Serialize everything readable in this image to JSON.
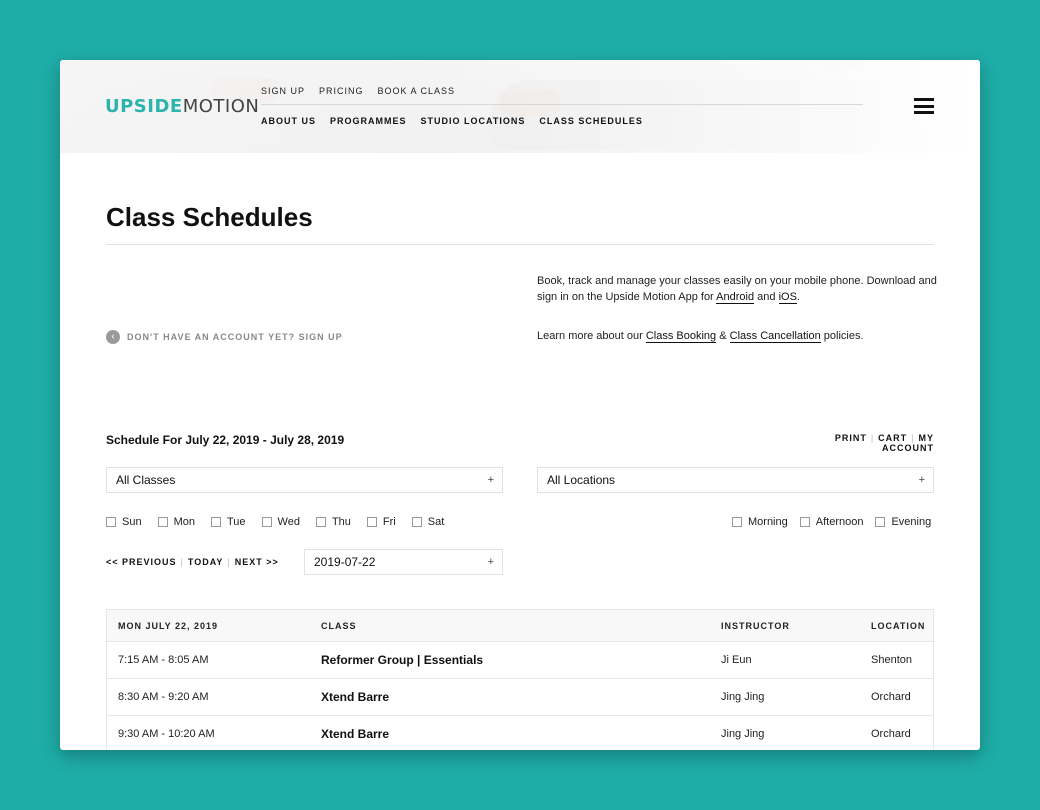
{
  "brand": {
    "logo_part1": "UPSIDE",
    "logo_part2": "MOTION",
    "accent_color": "#2bb3ad",
    "background_color": "#1fada8"
  },
  "nav": {
    "top": [
      "SIGN UP",
      "PRICING",
      "BOOK A CLASS"
    ],
    "main": [
      "ABOUT US",
      "PROGRAMMES",
      "STUDIO LOCATIONS",
      "CLASS SCHEDULES"
    ],
    "menu_icon": "hamburger-icon"
  },
  "page": {
    "title": "Class Schedules",
    "signup_link": "DON'T HAVE AN ACCOUNT YET? SIGN UP",
    "info_line1_pre": "Book, track and manage your classes easily on your mobile phone. Download and sign in on the Upside Motion App for ",
    "info_android": "Android",
    "info_and": " and ",
    "info_ios": "iOS",
    "info_line1_end": ".",
    "info_line2_pre": "Learn more about our ",
    "info_booking": "Class Booking",
    "info_amp": " & ",
    "info_cancellation": "Class Cancellation",
    "info_line2_end": " policies."
  },
  "schedule": {
    "heading": "Schedule For July 22, 2019 - July 28, 2019",
    "links": [
      "PRINT",
      "CART",
      "MY ACCOUNT"
    ],
    "class_filter": "All Classes",
    "location_filter": "All Locations",
    "days": [
      "Sun",
      "Mon",
      "Tue",
      "Wed",
      "Thu",
      "Fri",
      "Sat"
    ],
    "times": [
      "Morning",
      "Afternoon",
      "Evening"
    ],
    "pager": {
      "previous": "<< PREVIOUS",
      "today": "TODAY",
      "next": "NEXT >>"
    },
    "date": "2019-07-22",
    "plus": "+"
  },
  "table": {
    "headers": {
      "date": "MON JULY 22, 2019",
      "class": "CLASS",
      "instructor": "INSTRUCTOR",
      "location": "LOCATION"
    },
    "rows": [
      {
        "time": "7:15 AM - 8:05 AM",
        "class": "Reformer Group | Essentials",
        "instructor": "Ji Eun",
        "location": "Shenton"
      },
      {
        "time": "8:30 AM - 9:20 AM",
        "class": "Xtend Barre",
        "instructor": "Jing Jing",
        "location": "Orchard"
      },
      {
        "time": "9:30 AM - 10:20 AM",
        "class": "Xtend Barre",
        "instructor": "Jing Jing",
        "location": "Orchard"
      }
    ]
  }
}
